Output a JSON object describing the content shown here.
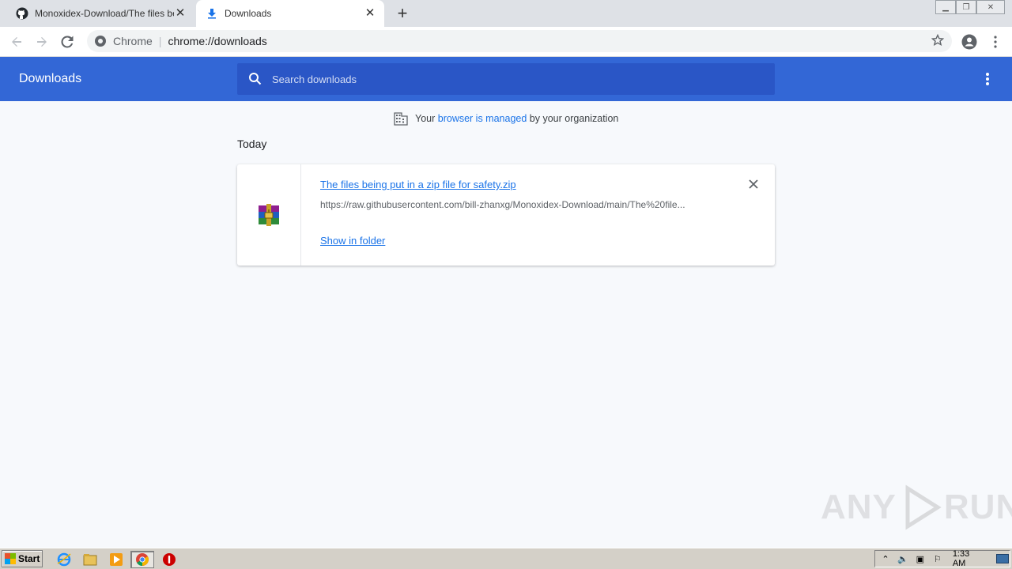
{
  "tabs": [
    {
      "title": "Monoxidex-Download/The files being put in a zip file for safety.zip",
      "active": false
    },
    {
      "title": "Downloads",
      "active": true
    }
  ],
  "omnibox": {
    "site_label": "Chrome",
    "url": "chrome://downloads"
  },
  "header": {
    "title": "Downloads",
    "search_placeholder": "Search downloads"
  },
  "managed_notice": {
    "prefix": "Your ",
    "link": "browser is managed",
    "suffix": " by your organization"
  },
  "section_label": "Today",
  "download": {
    "filename": "The files being put in a zip file for safety.zip",
    "url": "https://raw.githubusercontent.com/bill-zhanxg/Monoxidex-Download/main/The%20file...",
    "action": "Show in folder"
  },
  "watermark": {
    "left": "ANY",
    "right": "RUN"
  },
  "taskbar": {
    "start_label": "Start",
    "clock": "1:33 AM"
  },
  "colors": {
    "header_bg": "#3367d6",
    "search_bg": "#2a56c6",
    "link": "#1a73e8",
    "page_bg": "#f7f9fc"
  }
}
